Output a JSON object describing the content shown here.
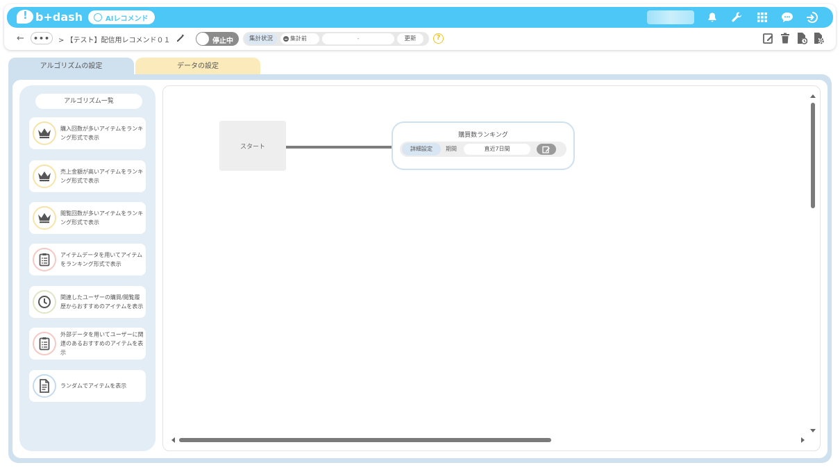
{
  "header": {
    "logo_text": "b+dash",
    "app_badge": "AIレコメンド",
    "icons": [
      "bell-icon",
      "wrench-icon",
      "grid-icon",
      "support-chat-icon",
      "logout-icon"
    ]
  },
  "subbar": {
    "back_symbol": "←",
    "more_symbol": "•••",
    "breadcrumb": "> 【テスト】配信用レコメンド０１",
    "toggle_label": "停止中",
    "status_label": "集計状況",
    "status_state": "集計前",
    "status_value": "-",
    "update_label": "更新",
    "help_symbol": "?",
    "action_icons": [
      "edit-icon",
      "delete-icon",
      "history-icon",
      "settings-icon"
    ]
  },
  "tabs": [
    {
      "label": "アルゴリズムの設定",
      "active": true
    },
    {
      "label": "データの設定",
      "active": false
    }
  ],
  "sidebar": {
    "title": "アルゴリズム一覧",
    "items": [
      {
        "icon": "crown-icon",
        "ring": "#f7e3a8",
        "label": "購入回数が多いアイテムをランキング形式で表示"
      },
      {
        "icon": "crown-icon",
        "ring": "#f7e3a8",
        "label": "売上金額が高いアイテムをランキング形式で表示"
      },
      {
        "icon": "crown-icon",
        "ring": "#f7e3a8",
        "label": "閲覧回数が多いアイテムをランキング形式で表示"
      },
      {
        "icon": "clipboard-list-icon",
        "ring": "#f6c8c4",
        "label": "アイテムデータを用いてアイテムをランキング形式で表示"
      },
      {
        "icon": "clock-icon",
        "ring": "#dfe6c6",
        "label": "関連したユーザーの購買/閲覧履歴からおすすめのアイテムを表示"
      },
      {
        "icon": "clipboard-list-icon",
        "ring": "#f6c8c4",
        "label": "外部データを用いてユーザーに関連のあるおすすめのアイテムを表示"
      },
      {
        "icon": "document-icon",
        "ring": "#c5daee",
        "label": "ランダムでアイテムを表示"
      }
    ]
  },
  "canvas": {
    "start_label": "スタート",
    "node": {
      "title": "購買数ランキング",
      "detail_label": "詳細設定",
      "period_label": "期間",
      "period_value": "直近7日間"
    }
  },
  "colors": {
    "brand": "#4dc7f5",
    "panel": "#cfe0ef",
    "data_tab": "#fbebbb",
    "help": "#f2c315"
  }
}
